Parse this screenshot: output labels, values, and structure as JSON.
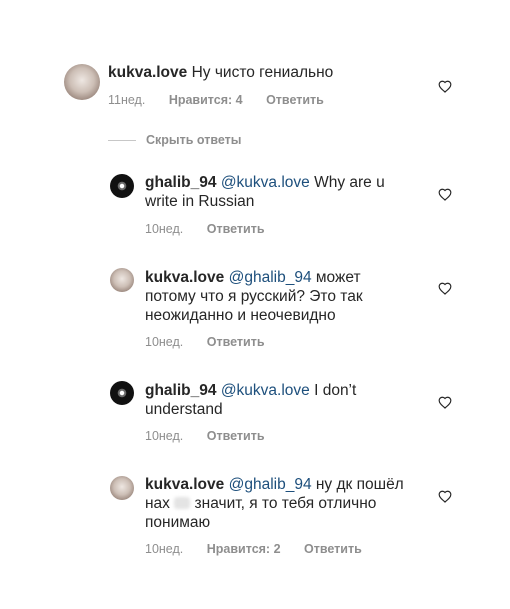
{
  "comments": [
    {
      "user": "kukva.love",
      "text": "Ну чисто гениально",
      "time": "11нед.",
      "likes": "Нравится: 4",
      "reply": "Ответить"
    }
  ],
  "hide_replies": "Скрыть ответы",
  "replies": [
    {
      "user": "ghalib_94",
      "mention": "@kukva.love",
      "text": " Why are u write in Russian",
      "time": "10нед.",
      "reply": "Ответить"
    },
    {
      "user": "kukva.love",
      "mention": "@ghalib_94",
      "text": " может потому что я русский? Это так неожиданно и неочевидно",
      "time": "10нед.",
      "reply": "Ответить"
    },
    {
      "user": "ghalib_94",
      "mention": "@kukva.love",
      "text": " I don’t understand",
      "time": "10нед.",
      "reply": "Ответить"
    },
    {
      "user": "kukva.love",
      "mention": "@ghalib_94",
      "text_a": " ну дк пошёл нах",
      "text_b": " значит, я то тебя отлично понимаю",
      "time": "10нед.",
      "likes": "Нравится: 2",
      "reply": "Ответить"
    }
  ],
  "colors": {
    "text": "#262626",
    "mention": "#1d4f7c",
    "meta": "#8e8e8e"
  },
  "icons": {
    "like": "heart-outline-icon"
  }
}
